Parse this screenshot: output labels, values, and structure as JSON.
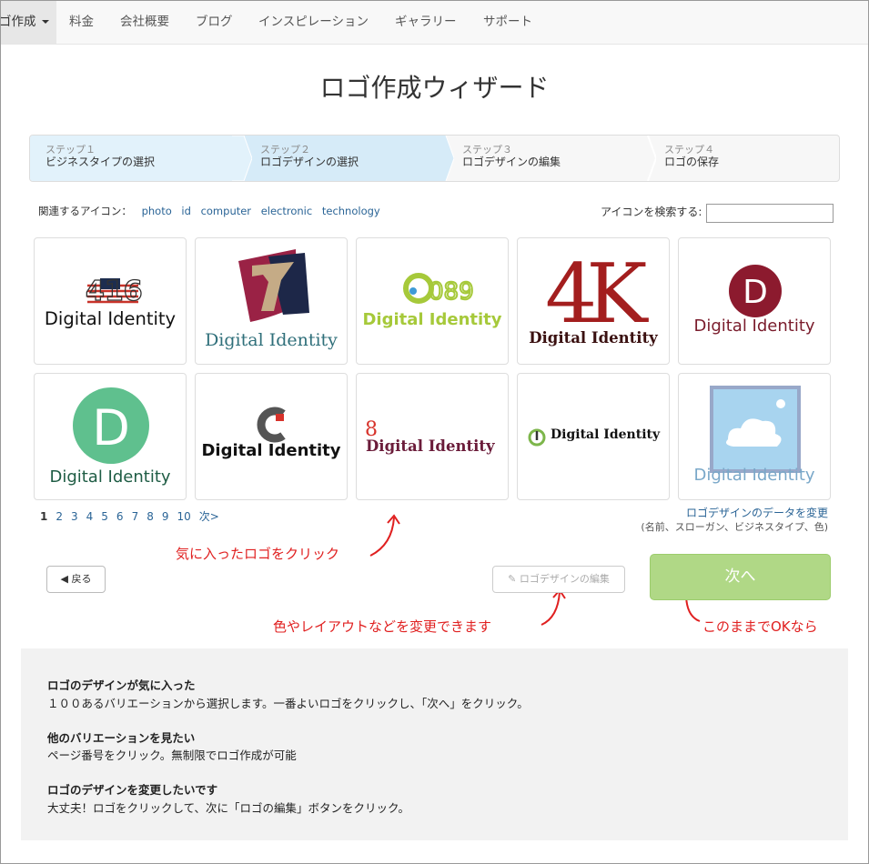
{
  "nav": {
    "items": [
      {
        "label": "ゴ作成"
      },
      {
        "label": "料金"
      },
      {
        "label": "会社概要"
      },
      {
        "label": "ブログ"
      },
      {
        "label": "インスピレーション"
      },
      {
        "label": "ギャラリー"
      },
      {
        "label": "サポート"
      }
    ]
  },
  "title": "ロゴ作成ウィザード",
  "steps": [
    {
      "num": "ステップ１",
      "label": "ビジネスタイプの選択"
    },
    {
      "num": "ステップ２",
      "label": "ロゴデザインの選択"
    },
    {
      "num": "ステップ３",
      "label": "ロゴデザインの編集"
    },
    {
      "num": "ステップ４",
      "label": "ロゴの保存"
    }
  ],
  "related": {
    "label": "関連するアイコン：",
    "tags": [
      "photo",
      "id",
      "computer",
      "electronic",
      "technology"
    ]
  },
  "search": {
    "label": "アイコンを検索する:",
    "value": ""
  },
  "logos": [
    {
      "icon": "flag-416-icon",
      "text": "Digital Identity",
      "color": "#111111"
    },
    {
      "icon": "number-7-shield-icon",
      "text": "Digital Identity",
      "color": "#2f6f7a"
    },
    {
      "icon": "i089-circle-icon",
      "text": "Digital Identity",
      "color": "#a6c93a"
    },
    {
      "icon": "4k-icon",
      "text": "Digital Identity",
      "color": "#3a1010"
    },
    {
      "icon": "d-circle-red-icon",
      "text": "Digital Identity",
      "color": "#7a1c2c"
    },
    {
      "icon": "d-circle-green-icon",
      "text": "Digital Identity",
      "color": "#1e5c44"
    },
    {
      "icon": "c-letter-icon",
      "text": "Digital Identity",
      "color": "#111111"
    },
    {
      "icon": "number-8-icon",
      "text": "Digital Identity",
      "color": "#6b1c3a"
    },
    {
      "icon": "power-ring-icon",
      "text": "Digital Identity",
      "color": "#111111"
    },
    {
      "icon": "cloud-picture-icon",
      "text": "Digital Identity",
      "color": "#7aa8c9"
    }
  ],
  "pager": {
    "pages": [
      "1",
      "2",
      "3",
      "4",
      "5",
      "6",
      "7",
      "8",
      "9",
      "10",
      "次>"
    ],
    "current": "1"
  },
  "change": {
    "link": "ロゴデザインのデータを変更",
    "sub": "(名前、スローガン、ビジネスタイプ、色)"
  },
  "notes": {
    "click": "気に入ったロゴをクリック",
    "edit": "色やレイアウトなどを変更できます",
    "ok": "このままでOKなら"
  },
  "buttons": {
    "back": "戻る",
    "edit": "ロゴデザインの編集",
    "next": "次へ"
  },
  "help": [
    {
      "title": "ロゴのデザインが気に入った",
      "text": "１００あるバリエーションから選択します。一番よいロゴをクリックし、「次へ」をクリック。"
    },
    {
      "title": "他のバリエーションを見たい",
      "text": "ページ番号をクリック。無制限でロゴ作成が可能"
    },
    {
      "title": "ロゴのデザインを変更したいです",
      "text": "大丈夫！ロゴをクリックして、次に「ロゴの編集」ボタンをクリック。"
    }
  ],
  "colors": {
    "accent": "#2a6496",
    "next_button": "#b0d886",
    "step_active": "#d6ebf8",
    "annotation": "#e02020"
  }
}
